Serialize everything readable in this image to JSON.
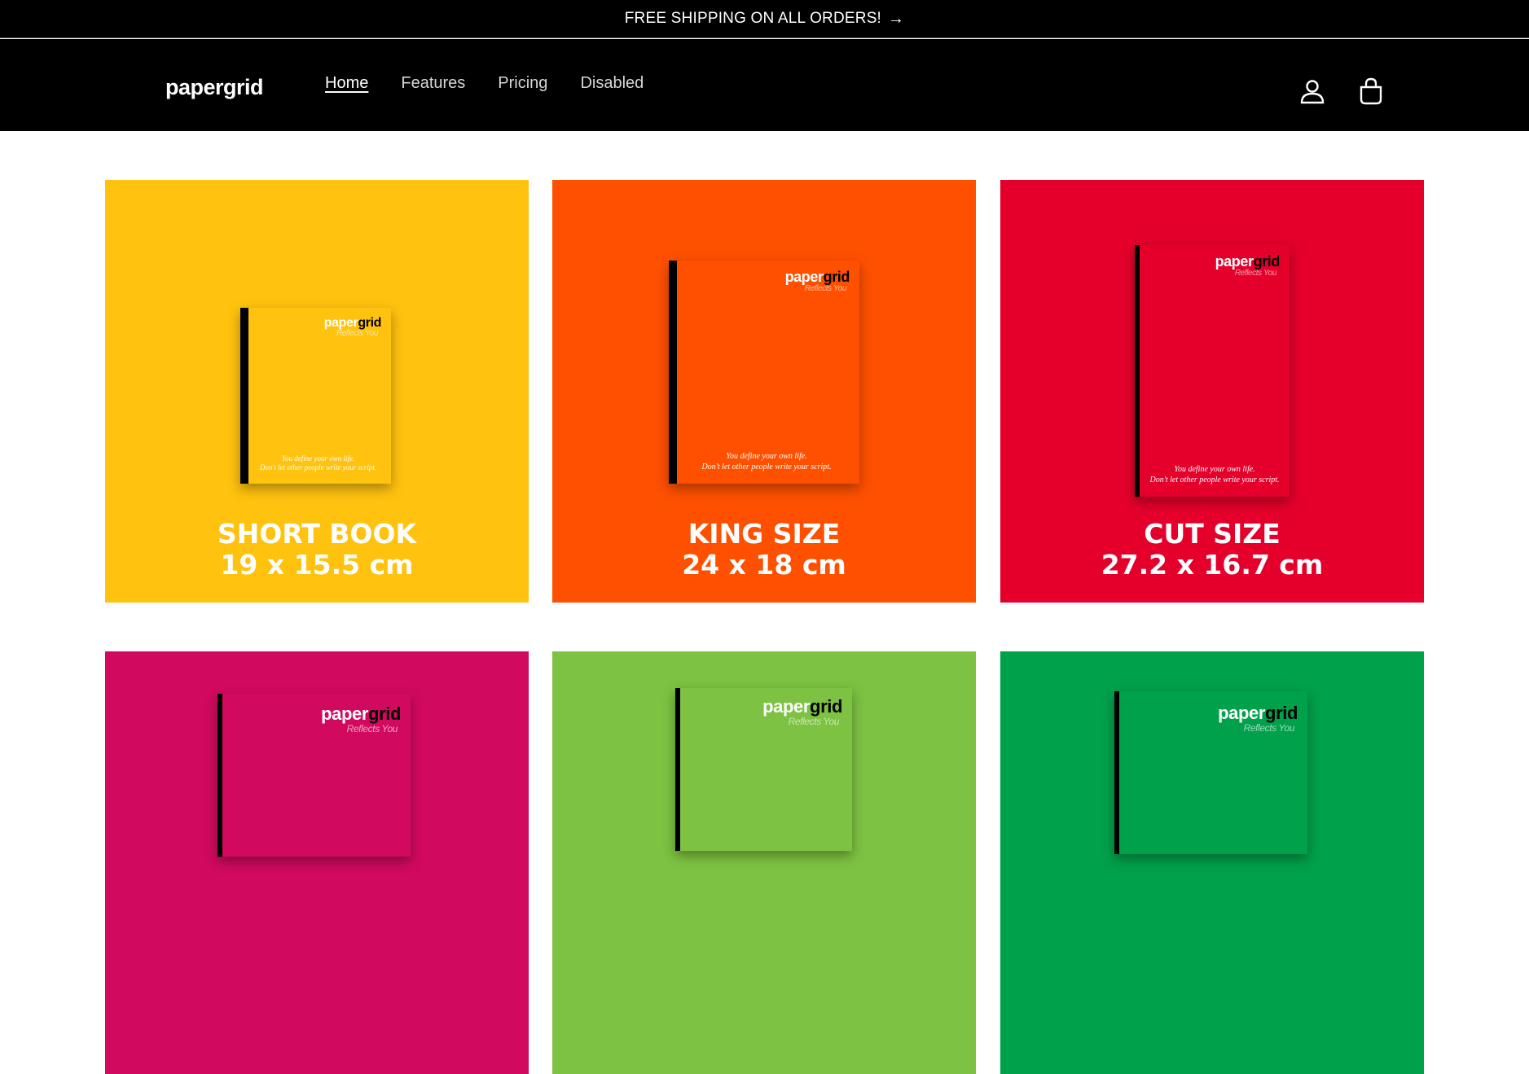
{
  "announcement": {
    "text": "FREE SHIPPING ON ALL ORDERS!",
    "arrow": "→"
  },
  "header": {
    "logo": "papergrid",
    "nav": [
      {
        "label": "Home",
        "active": true
      },
      {
        "label": "Features",
        "active": false
      },
      {
        "label": "Pricing",
        "active": false
      },
      {
        "label": "Disabled",
        "active": false
      }
    ],
    "icons": [
      "account-icon",
      "cart-icon"
    ]
  },
  "products": [
    {
      "name": "SHORT BOOK",
      "size": "19 x 15.5 cm",
      "color": "#FFC20E",
      "brand_light": "paper",
      "brand_dark": "grid",
      "tagline": "Reflects You",
      "quote_line1": "You define your own life.",
      "quote_line2": "Don't let other people write your script."
    },
    {
      "name": "KING SIZE",
      "size": "24 x 18 cm",
      "color": "#FF5000",
      "brand_light": "paper",
      "brand_dark": "grid",
      "tagline": "Reflects You",
      "quote_line1": "You define your own life.",
      "quote_line2": "Don't let other people write your script."
    },
    {
      "name": "CUT SIZE",
      "size": "27.2 x 16.7 cm",
      "color": "#E4002B",
      "brand_light": "paper",
      "brand_dark": "grid",
      "tagline": "Reflects You",
      "quote_line1": "You define your own life.",
      "quote_line2": "Don't let other people write your script."
    },
    {
      "color": "#D10A5F",
      "brand_light": "paper",
      "brand_dark": "grid",
      "tagline": "Reflects You"
    },
    {
      "color": "#7DC242",
      "brand_light": "paper",
      "brand_dark": "grid",
      "tagline": "Reflects You"
    },
    {
      "color": "#00A14B",
      "brand_light": "paper",
      "brand_dark": "grid",
      "tagline": "Reflects You"
    }
  ]
}
